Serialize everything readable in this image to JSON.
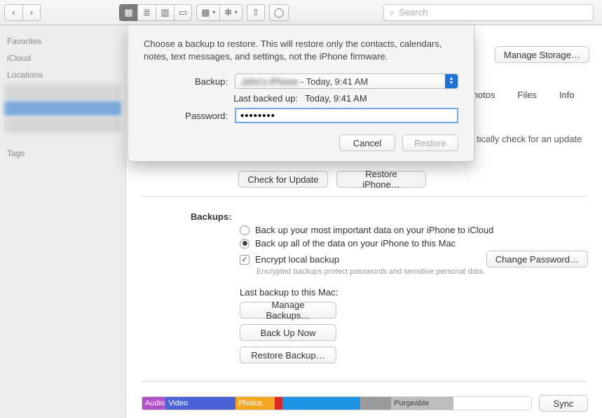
{
  "toolbar": {
    "search_placeholder": "Search"
  },
  "sidebar": {
    "favorites": "Favorites",
    "icloud": "iCloud",
    "locations": "Locations",
    "tags": "Tags"
  },
  "top": {
    "manage_storage": "Manage Storage…",
    "tabs": {
      "photos": "Photos",
      "files": "Files",
      "info": "Info"
    }
  },
  "updates": {
    "note": "tically check for an update",
    "check_btn": "Check for Update",
    "restore_btn": "Restore iPhone…"
  },
  "backups": {
    "label": "Backups:",
    "radio_icloud": "Back up your most important data on your iPhone to iCloud",
    "radio_mac": "Back up all of the data on your iPhone to this Mac",
    "encrypt": "Encrypt local backup",
    "encrypt_hint": "Encrypted backups protect passwords and sensitive personal data.",
    "change_pw": "Change Password…",
    "last_line": "Last backup to this Mac:",
    "manage": "Manage Backups…",
    "backup_now": "Back Up Now",
    "restore": "Restore Backup…"
  },
  "storage": {
    "audio": "Audio",
    "video": "Video",
    "photos": "Photos",
    "purgeable": "Purgeable",
    "sync": "Sync"
  },
  "sheet": {
    "msg": "Choose a backup to restore. This will restore only the contacts, calendars, notes, text messages, and settings, not the iPhone firmware.",
    "backup_label": "Backup:",
    "backup_name": "John's iPhone",
    "backup_time": " - Today, 9:41 AM",
    "lbu_label": "Last backed up:",
    "lbu_value": "Today, 9:41 AM",
    "pw_label": "Password:",
    "pw_value": "••••••••",
    "cancel": "Cancel",
    "restore": "Restore"
  }
}
